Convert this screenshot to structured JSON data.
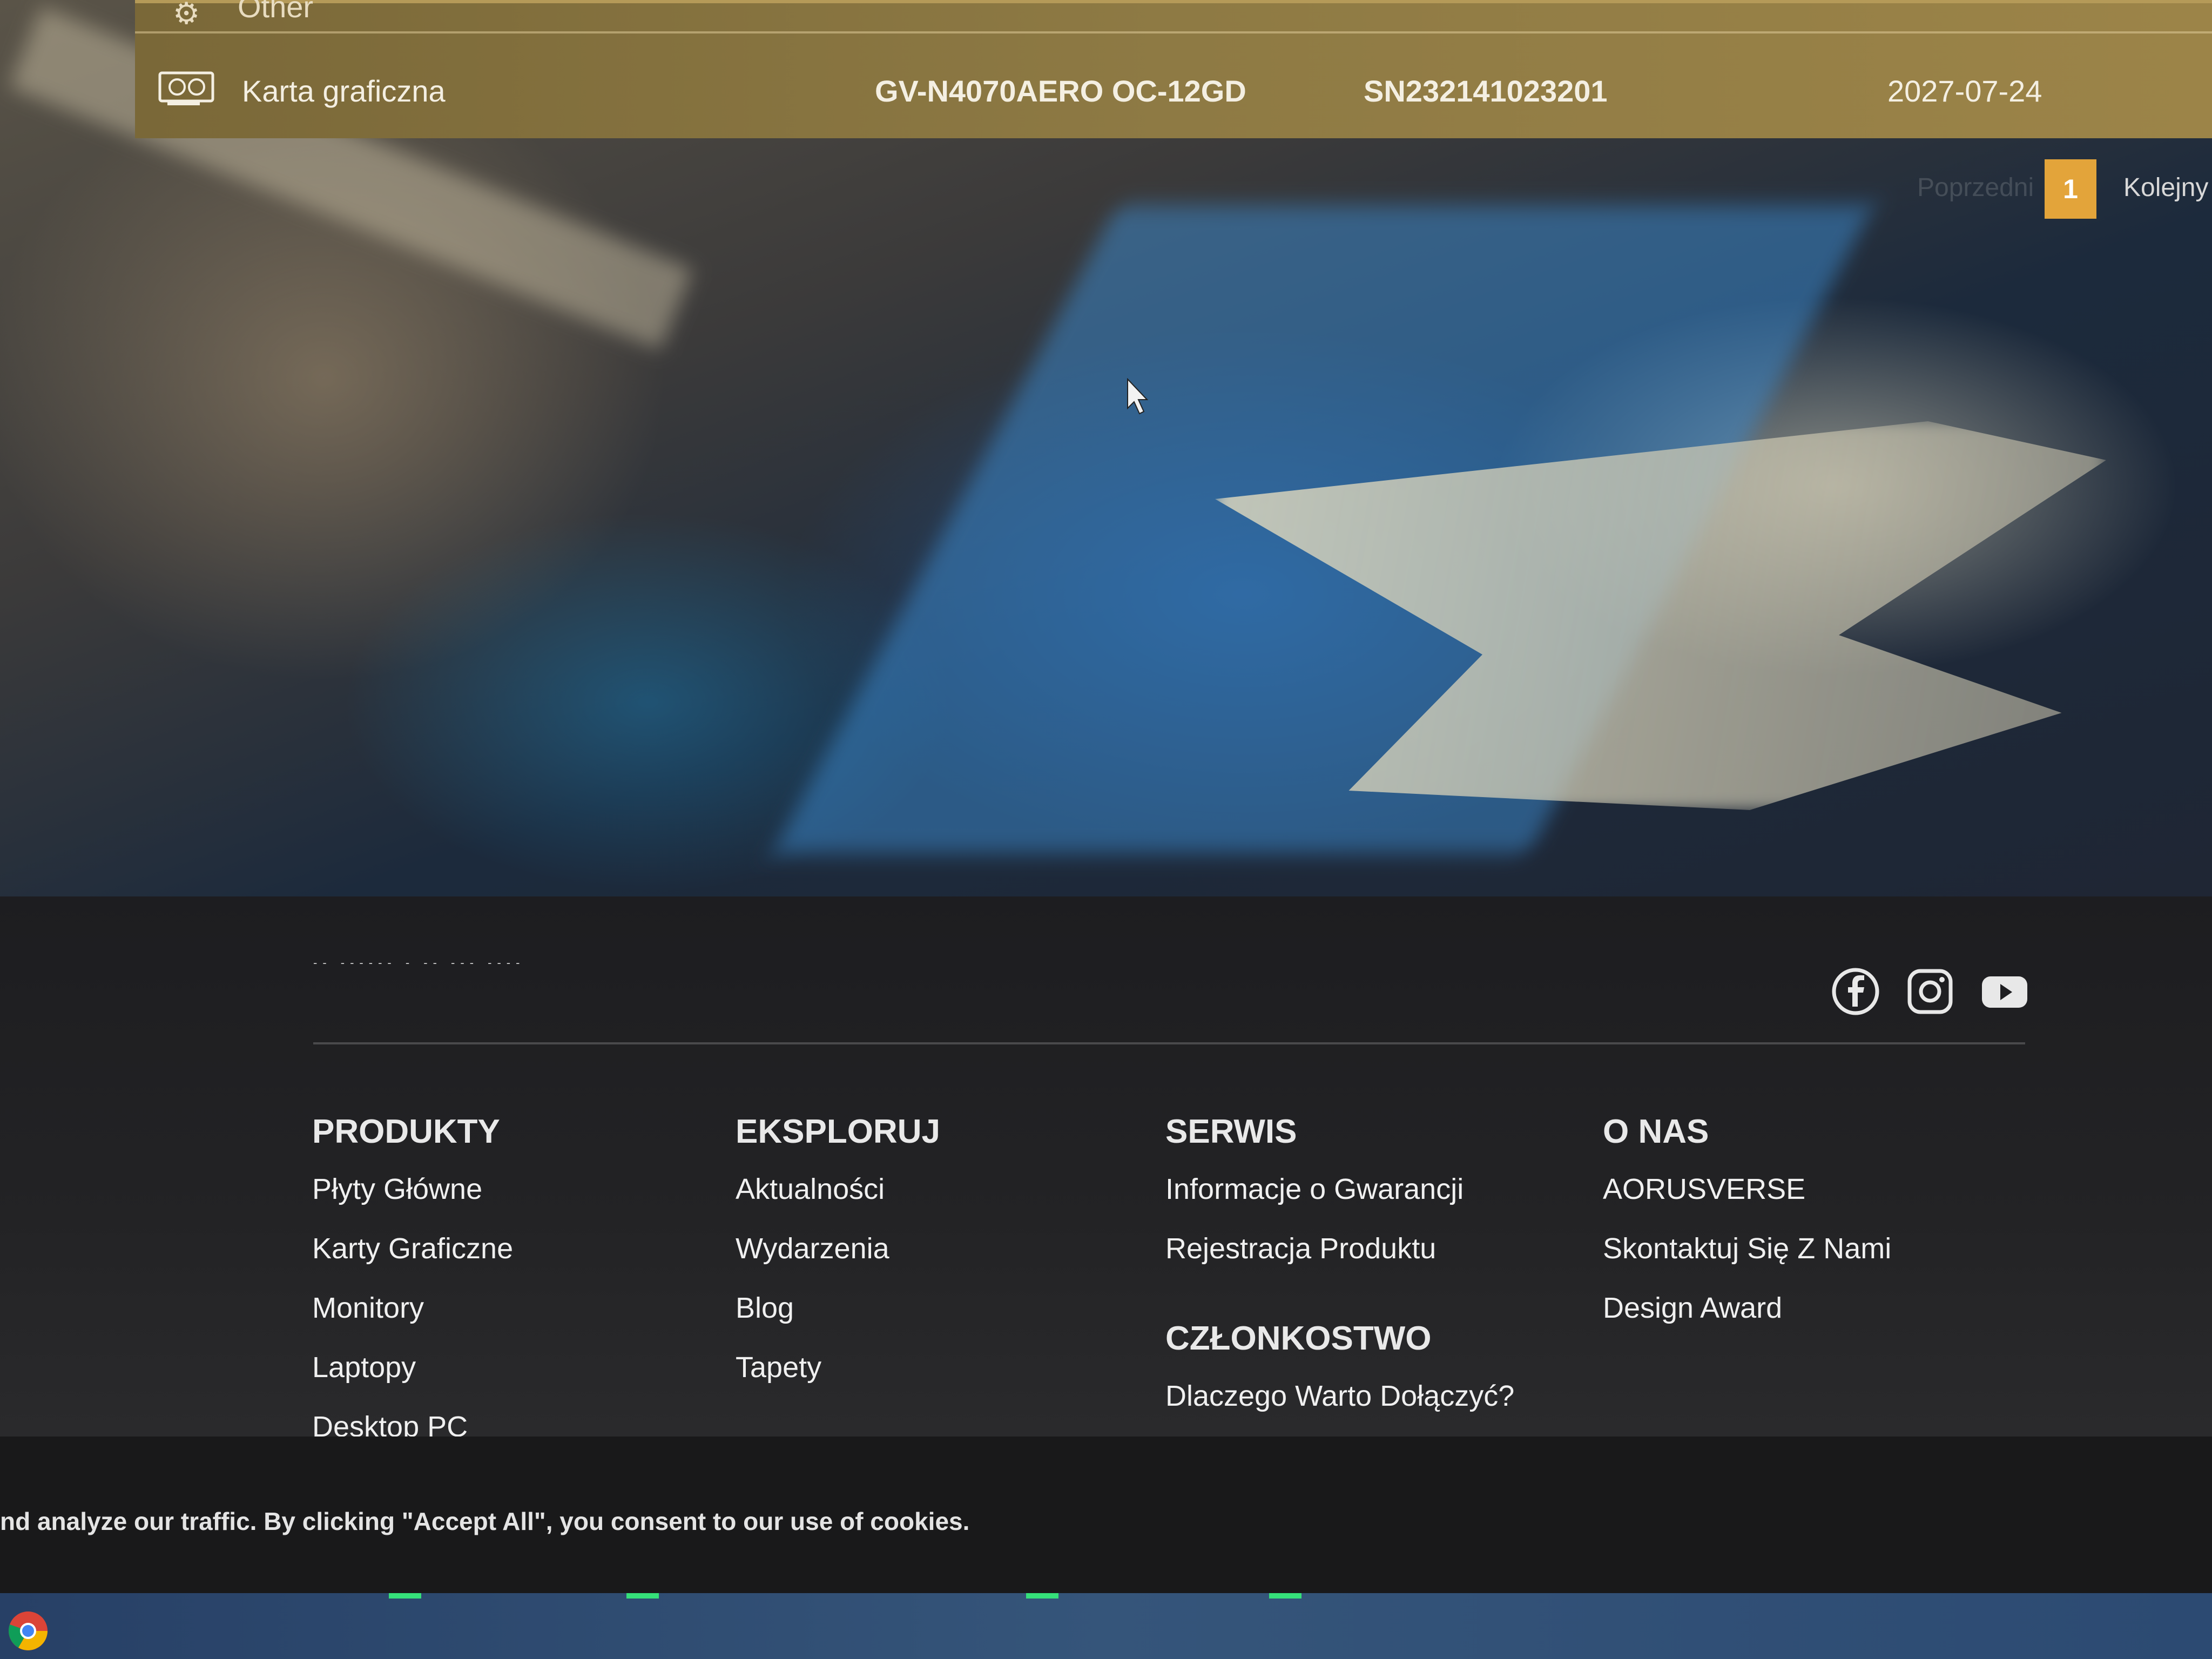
{
  "warranty_table": {
    "previous_row_label": "Other",
    "row": {
      "category": "Karta graficzna",
      "model": "GV-N4070AERO OC-12GD",
      "serial": "SN232141023201",
      "date": "2027-07-24"
    }
  },
  "pagination": {
    "prev_label": "Poprzedni",
    "current_page": "1",
    "next_label": "Kolejny"
  },
  "footer": {
    "tagline": "-- ------ - -- --- ----",
    "columns": [
      {
        "heading": "PRODUKTY",
        "links": [
          "Płyty Główne",
          "Karty Graficzne",
          "Monitory",
          "Laptopy",
          "Desktop PC"
        ]
      },
      {
        "heading": "EKSPLORUJ",
        "links": [
          "Aktualności",
          "Wydarzenia",
          "Blog",
          "Tapety"
        ]
      },
      {
        "heading": "SERWIS",
        "links": [
          "Informacje o Gwarancji",
          "Rejestracja Produktu"
        ],
        "subheading": "CZŁONKOSTWO",
        "sublinks": [
          "Dlaczego Warto Dołączyć?"
        ]
      },
      {
        "heading": "O NAS",
        "links": [
          "AORUSVERSE",
          "Skontaktuj Się Z Nami",
          "Design Award"
        ]
      }
    ],
    "social": [
      "facebook-icon",
      "instagram-icon",
      "youtube-icon"
    ]
  },
  "cookie_banner": {
    "text": "nd analyze our traffic. By clicking \"Accept All\", you consent to our use of cookies."
  },
  "colors": {
    "row_background": "#8e7a44",
    "page_active": "#e3a43a",
    "footer_background": "#1d1d20",
    "taskbar": "#35557a"
  }
}
